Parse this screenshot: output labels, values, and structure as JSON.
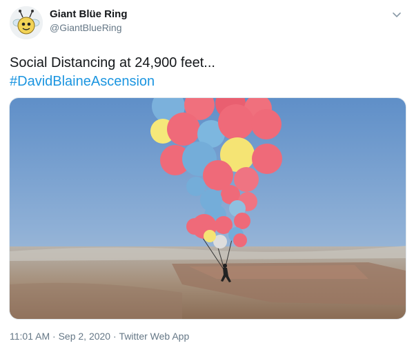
{
  "account": {
    "display_name": "Giant Blüe Ring",
    "handle": "@GiantBlueRing"
  },
  "tweet": {
    "text": "Social Distancing at 24,900 feet...",
    "hashtag": "#DavidBlaineAscension",
    "media_description_icon": "photo"
  },
  "meta": {
    "time": "11:01 AM",
    "separator": "·",
    "date": "Sep 2, 2020",
    "source": "Twitter Web App"
  },
  "colors": {
    "link": "#1b95e0",
    "secondary_text": "#657786",
    "primary_text": "#14171a"
  },
  "icons": {
    "menu": "chevron-down-icon"
  }
}
